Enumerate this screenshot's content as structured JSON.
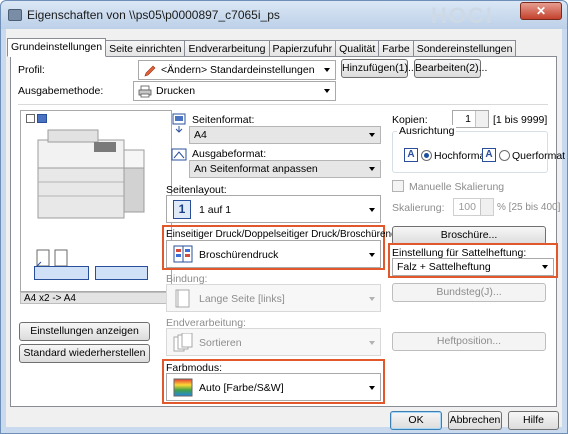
{
  "window": {
    "title": "Eigenschaften von \\\\ps05\\p0000897_c7065i_ps",
    "close_label": "✕"
  },
  "tabs": [
    {
      "label": "Grundeinstellungen",
      "active": true
    },
    {
      "label": "Seite einrichten",
      "active": false
    },
    {
      "label": "Endverarbeitung",
      "active": false
    },
    {
      "label": "Papierzufuhr",
      "active": false
    },
    {
      "label": "Qualität",
      "active": false
    },
    {
      "label": "Farbe",
      "active": false
    },
    {
      "label": "Sondereinstellungen",
      "active": false
    }
  ],
  "profile": {
    "label": "Profil:",
    "value": "<Ändern> Standardeinstellungen",
    "add_button": "Hinzufügen(1)...",
    "edit_button": "Bearbeiten(2)..."
  },
  "output": {
    "label": "Ausgabemethode:",
    "value": "Drucken"
  },
  "preview": {
    "caption": "A4 x2 -> A4",
    "show_settings_button": "Einstellungen anzeigen",
    "restore_defaults_button": "Standard wiederherstellen"
  },
  "page_format": {
    "label": "Seitenformat:",
    "value": "A4"
  },
  "output_format": {
    "label": "Ausgabeformat:",
    "value": "An Seitenformat anpassen"
  },
  "layout": {
    "label": "Seitenlayout:",
    "number": "1",
    "value": "1 auf 1"
  },
  "duplex": {
    "label": "Einseitiger Druck/Doppelseitiger Druck/Broschürendruck:",
    "value": "Broschürendruck"
  },
  "binding": {
    "label": "Bindung:",
    "value": "Lange Seite [links]"
  },
  "finishing": {
    "label": "Endverarbeitung:",
    "value": "Sortieren"
  },
  "color_mode": {
    "label": "Farbmodus:",
    "value": "Auto [Farbe/S&W]"
  },
  "copies": {
    "label": "Kopien:",
    "value": "1",
    "range": "[1 bis 9999]"
  },
  "orientation": {
    "label": "Ausrichtung",
    "portrait": "Hochformat",
    "landscape": "Querformat",
    "selected": "portrait"
  },
  "scaling": {
    "manual_label": "Manuelle Skalierung",
    "label": "Skalierung:",
    "value": "100",
    "range": "% [25 bis 400]"
  },
  "booklet_button": "Broschüre...",
  "saddle": {
    "label": "Einstellung für Sattelheftung:",
    "value": "Falz + Sattelheftung"
  },
  "gutter_button": "Bundsteg(J)...",
  "staple_button": "Heftposition...",
  "footer": {
    "ok": "OK",
    "cancel": "Abbrechen",
    "help": "Hilfe"
  }
}
